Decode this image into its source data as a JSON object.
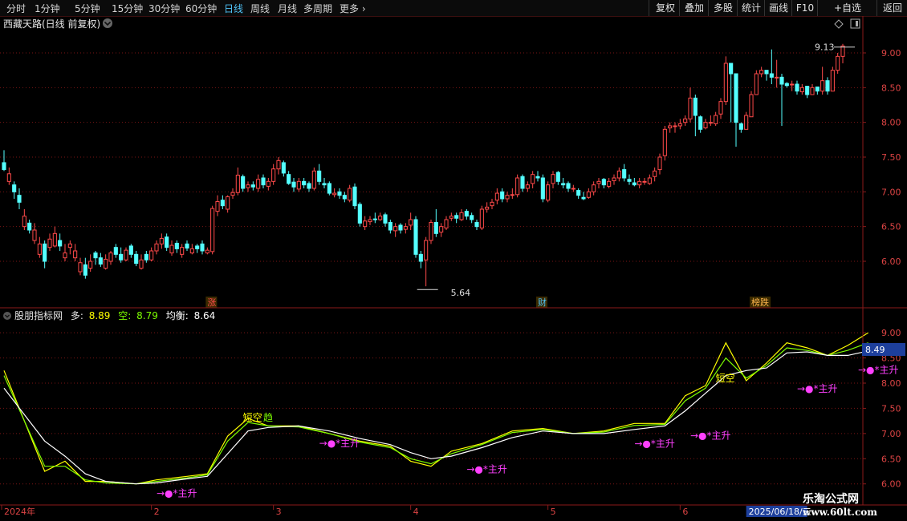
{
  "toolbar": {
    "timeframes": [
      "分时",
      "1分钟",
      "5分钟",
      "15分钟",
      "30分钟",
      "60分钟",
      "日线",
      "周线",
      "月线",
      "多周期",
      "更多"
    ],
    "active_index": 6,
    "right_buttons": [
      "复权",
      "叠加",
      "多股",
      "统计",
      "画线",
      "F10",
      "+自选",
      "返回"
    ]
  },
  "main": {
    "title": "西藏天路(日线 前复权)"
  },
  "indicator": {
    "title": "股朋指标网",
    "duo_label": "多:",
    "duo_value": "8.89",
    "kong_label": "空:",
    "kong_value": "8.79",
    "jun_label": "均衡:",
    "jun_value": "8.64",
    "current_value": "8.49"
  },
  "watermark": {
    "line1": "乐淘公式网",
    "line2": "www.60lt.com"
  },
  "colors": {
    "up": "#ff4a4a",
    "down": "#54ffff",
    "grid": "#7a1515",
    "line_duo": "#ffff00",
    "line_kong": "#7cfc00",
    "line_jun": "#ffffff",
    "signal": "#ff40ff",
    "yellow": "#ffff00",
    "green": "#7cfc00"
  },
  "chart_data": [
    {
      "type": "candlestick",
      "title": "西藏天路(日线 前复权)",
      "ylim": [
        5.55,
        9.3
      ],
      "y_ticks": [
        6.0,
        6.5,
        7.0,
        7.5,
        8.0,
        8.5,
        9.0
      ],
      "y_tick_labels": [
        "6.00",
        "6.50",
        "7.00",
        "7.50",
        "8.00",
        "8.50",
        "9.00"
      ],
      "x_labels": [
        {
          "label": "2024年",
          "index": 0
        },
        {
          "label": "2",
          "index": 29
        },
        {
          "label": "3",
          "index": 53
        },
        {
          "label": "4",
          "index": 80
        },
        {
          "label": "5",
          "index": 107
        },
        {
          "label": "6",
          "index": 133
        }
      ],
      "date_box": {
        "label": "2025/06/18/三",
        "index": 146
      },
      "annotations": [
        {
          "label": "9.13",
          "index": 168,
          "price": 9.13
        },
        {
          "label": "5.64",
          "index": 86,
          "price": 5.64
        }
      ],
      "markers": [
        {
          "label": "涨",
          "index": 40
        },
        {
          "label": "财",
          "index": 105
        },
        {
          "label": "榜跌",
          "index": 147
        }
      ],
      "close": [
        7.32,
        7.26,
        7.0,
        6.85,
        6.65,
        6.45,
        6.45,
        6.25,
        6.0,
        6.32,
        6.4,
        6.22,
        6.12,
        6.25,
        6.15,
        5.98,
        5.8,
        6.0,
        6.05,
        5.96,
        6.03,
        6.12,
        6.1,
        6.02,
        6.16,
        6.1,
        5.97,
        6.02,
        6.02,
        6.15,
        6.25,
        6.33,
        6.2,
        6.23,
        6.18,
        6.2,
        6.19,
        6.18,
        6.18,
        6.15,
        6.16,
        6.76,
        6.86,
        6.8,
        6.93,
        6.99,
        7.24,
        7.05,
        7.1,
        7.07,
        7.18,
        7.1,
        7.15,
        7.33,
        7.45,
        7.27,
        7.12,
        7.07,
        7.15,
        7.1,
        7.05,
        7.3,
        7.15,
        7.1,
        6.98,
        6.98,
        6.95,
        6.9,
        7.05,
        6.8,
        6.55,
        6.58,
        6.6,
        6.6,
        6.65,
        6.55,
        6.45,
        6.5,
        6.45,
        6.5,
        6.6,
        6.1,
        6.0,
        6.3,
        6.56,
        6.4,
        6.5,
        6.6,
        6.65,
        6.62,
        6.7,
        6.65,
        6.6,
        6.5,
        6.75,
        6.78,
        6.85,
        6.98,
        6.9,
        6.95,
        6.96,
        7.2,
        7.05,
        7.1,
        7.25,
        7.2,
        6.9,
        7.1,
        7.25,
        7.15,
        7.1,
        7.05,
        7.05,
        6.95,
        6.9,
        7.0,
        7.1,
        7.15,
        7.1,
        7.15,
        7.2,
        7.3,
        7.2,
        7.15,
        7.1,
        7.15,
        7.15,
        7.2,
        7.3,
        7.5,
        7.9,
        7.95,
        7.95,
        7.98,
        8.05,
        8.35,
        8.1,
        7.9,
        8.0,
        8.0,
        8.1,
        8.3,
        8.85,
        8.7,
        8.0,
        7.9,
        8.1,
        8.4,
        8.7,
        8.75,
        8.7,
        8.65,
        8.65,
        8.55,
        8.53,
        8.55,
        8.45,
        8.5,
        8.4,
        8.5,
        8.45,
        8.6,
        8.45,
        8.75,
        8.95,
        9.1
      ],
      "open": [
        7.42,
        7.15,
        7.1,
        6.95,
        6.5,
        6.55,
        6.3,
        6.1,
        6.25,
        6.2,
        6.22,
        6.3,
        6.05,
        6.2,
        6.05,
        5.85,
        5.95,
        5.9,
        6.12,
        6.05,
        5.9,
        6.0,
        6.2,
        6.1,
        6.02,
        6.22,
        6.1,
        5.9,
        6.1,
        6.02,
        6.15,
        6.25,
        6.35,
        6.12,
        6.26,
        6.1,
        6.25,
        6.12,
        6.22,
        6.25,
        6.12,
        6.14,
        6.72,
        6.88,
        6.75,
        6.95,
        6.99,
        7.22,
        7.06,
        7.1,
        7.05,
        7.2,
        7.08,
        7.15,
        7.33,
        7.42,
        7.25,
        7.14,
        7.04,
        7.15,
        7.12,
        7.05,
        7.3,
        7.12,
        7.12,
        6.96,
        7.0,
        6.95,
        6.88,
        7.07,
        6.82,
        6.5,
        6.57,
        6.61,
        6.6,
        6.67,
        6.56,
        6.44,
        6.52,
        6.46,
        6.52,
        6.6,
        6.1,
        6.02,
        6.3,
        6.56,
        6.42,
        6.48,
        6.62,
        6.66,
        6.6,
        6.72,
        6.66,
        6.56,
        6.48,
        6.75,
        6.8,
        6.88,
        7.0,
        6.9,
        6.96,
        6.96,
        7.22,
        7.05,
        7.12,
        7.22,
        7.2,
        6.88,
        7.12,
        7.28,
        7.12,
        7.12,
        7.05,
        7.02,
        6.92,
        6.92,
        7.0,
        7.12,
        7.18,
        7.08,
        7.16,
        7.2,
        7.32,
        7.18,
        7.13,
        7.1,
        7.15,
        7.12,
        7.22,
        7.32,
        7.52,
        7.92,
        7.95,
        7.95,
        8.0,
        8.05,
        8.35,
        8.08,
        7.92,
        8.0,
        7.98,
        8.12,
        8.3,
        8.85,
        8.7,
        7.98,
        7.9,
        8.08,
        8.4,
        8.7,
        8.75,
        8.7,
        8.65,
        8.65,
        8.56,
        8.54,
        8.55,
        8.44,
        8.52,
        8.4,
        8.51,
        8.45,
        8.6,
        8.45,
        8.75,
        8.95
      ],
      "high": [
        7.6,
        7.35,
        7.15,
        7.05,
        6.75,
        6.6,
        6.55,
        6.35,
        6.3,
        6.4,
        6.5,
        6.4,
        6.25,
        6.3,
        6.25,
        6.05,
        6.05,
        6.1,
        6.15,
        6.12,
        6.1,
        6.15,
        6.25,
        6.2,
        6.2,
        6.25,
        6.15,
        6.1,
        6.15,
        6.2,
        6.3,
        6.4,
        6.4,
        6.3,
        6.3,
        6.25,
        6.3,
        6.25,
        6.25,
        6.3,
        6.2,
        6.8,
        6.95,
        6.95,
        6.95,
        7.05,
        7.35,
        7.25,
        7.15,
        7.15,
        7.25,
        7.25,
        7.2,
        7.4,
        7.5,
        7.45,
        7.3,
        7.2,
        7.2,
        7.2,
        7.15,
        7.35,
        7.4,
        7.2,
        7.15,
        7.05,
        7.05,
        7.0,
        7.1,
        7.12,
        6.85,
        6.65,
        6.65,
        6.7,
        6.7,
        6.7,
        6.6,
        6.55,
        6.55,
        6.55,
        6.7,
        6.65,
        6.15,
        6.35,
        6.6,
        6.75,
        6.55,
        6.65,
        6.7,
        6.7,
        6.75,
        6.75,
        6.7,
        6.6,
        6.8,
        6.85,
        6.9,
        7.05,
        7.05,
        7.0,
        7.05,
        7.25,
        7.25,
        7.15,
        7.3,
        7.3,
        7.25,
        7.15,
        7.3,
        7.3,
        7.2,
        7.15,
        7.1,
        7.05,
        7.0,
        7.05,
        7.15,
        7.2,
        7.2,
        7.2,
        7.25,
        7.35,
        7.4,
        7.25,
        7.2,
        7.2,
        7.2,
        7.25,
        7.35,
        7.55,
        7.95,
        8.0,
        8.0,
        8.05,
        8.1,
        8.5,
        8.4,
        8.1,
        8.05,
        8.1,
        8.15,
        8.35,
        8.95,
        8.85,
        8.7,
        8.0,
        8.15,
        8.45,
        8.75,
        8.8,
        8.75,
        9.05,
        8.9,
        8.7,
        8.58,
        8.6,
        8.6,
        8.55,
        8.5,
        8.55,
        8.5,
        8.8,
        8.65,
        8.8,
        9.0,
        9.13
      ],
      "low": [
        7.3,
        7.1,
        6.9,
        6.75,
        6.45,
        6.4,
        6.25,
        6.05,
        5.9,
        6.15,
        6.2,
        6.15,
        6.0,
        6.1,
        6.0,
        5.8,
        5.75,
        5.85,
        5.95,
        5.92,
        5.88,
        5.95,
        6.05,
        5.98,
        6.0,
        6.05,
        5.93,
        5.88,
        5.98,
        6.0,
        6.1,
        6.18,
        6.15,
        6.08,
        6.12,
        6.05,
        6.15,
        6.1,
        6.12,
        6.1,
        6.1,
        6.1,
        6.65,
        6.75,
        6.7,
        6.9,
        6.95,
        7.0,
        7.0,
        7.02,
        7.0,
        7.05,
        7.02,
        7.1,
        7.25,
        7.22,
        7.1,
        7.0,
        7.0,
        7.05,
        7.0,
        7.02,
        7.1,
        7.05,
        6.95,
        6.92,
        6.9,
        6.85,
        6.85,
        6.75,
        6.5,
        6.45,
        6.52,
        6.55,
        6.58,
        6.5,
        6.4,
        6.35,
        6.4,
        6.4,
        6.45,
        6.05,
        5.9,
        5.64,
        6.25,
        6.35,
        6.35,
        6.45,
        6.58,
        6.55,
        6.58,
        6.6,
        6.55,
        6.45,
        6.45,
        6.7,
        6.75,
        6.82,
        6.85,
        6.85,
        6.9,
        6.92,
        7.0,
        7.0,
        7.05,
        7.15,
        6.85,
        6.85,
        7.05,
        7.1,
        7.05,
        7.0,
        7.0,
        6.9,
        6.88,
        6.9,
        6.95,
        7.05,
        7.05,
        7.05,
        7.1,
        7.15,
        7.15,
        7.1,
        7.08,
        7.05,
        7.1,
        7.1,
        7.15,
        7.25,
        7.45,
        7.85,
        7.85,
        7.9,
        7.95,
        8.0,
        7.8,
        7.85,
        7.9,
        7.95,
        7.95,
        8.05,
        8.25,
        8.0,
        7.65,
        7.85,
        8.05,
        8.35,
        8.65,
        8.65,
        8.6,
        8.55,
        8.5,
        7.95,
        8.5,
        8.45,
        8.4,
        8.4,
        8.35,
        8.4,
        8.4,
        8.4,
        8.4,
        8.45,
        8.7,
        8.85
      ]
    },
    {
      "type": "line",
      "title": "股朋指标网",
      "ylim": [
        5.9,
        9.4
      ],
      "y_ticks": [
        6.0,
        6.5,
        7.0,
        7.5,
        8.0,
        8.5,
        9.0
      ],
      "y_tick_labels": [
        "6.00",
        "6.50",
        "7.00",
        "7.50",
        "8.00",
        "8.50",
        "9.00"
      ],
      "series": [
        {
          "name": "多",
          "x": [
            0,
            8,
            12,
            16,
            20,
            26,
            30,
            36,
            40,
            44,
            48,
            52,
            58,
            64,
            70,
            76,
            80,
            84,
            88,
            94,
            100,
            106,
            112,
            118,
            124,
            130,
            134,
            138,
            142,
            146,
            150,
            154,
            158,
            162,
            166,
            170
          ],
          "values": [
            8.25,
            6.25,
            6.45,
            6.05,
            6.05,
            6.0,
            6.08,
            6.15,
            6.2,
            6.95,
            7.3,
            7.15,
            7.15,
            7.0,
            6.85,
            6.75,
            6.45,
            6.35,
            6.65,
            6.8,
            7.05,
            7.1,
            7.0,
            7.05,
            7.2,
            7.2,
            7.75,
            7.95,
            8.8,
            8.05,
            8.4,
            8.8,
            8.7,
            8.55,
            8.75,
            9.0
          ]
        },
        {
          "name": "空",
          "x": [
            0,
            8,
            12,
            16,
            20,
            26,
            30,
            36,
            40,
            44,
            48,
            52,
            58,
            64,
            70,
            76,
            80,
            84,
            88,
            94,
            100,
            106,
            112,
            118,
            124,
            130,
            134,
            138,
            142,
            146,
            150,
            154,
            158,
            162,
            166,
            170
          ],
          "values": [
            8.15,
            6.35,
            6.35,
            6.08,
            6.02,
            6.0,
            6.05,
            6.12,
            6.18,
            6.85,
            7.22,
            7.15,
            7.13,
            7.0,
            6.83,
            6.72,
            6.5,
            6.4,
            6.6,
            6.78,
            7.02,
            7.08,
            7.0,
            7.03,
            7.16,
            7.18,
            7.65,
            7.9,
            8.5,
            8.1,
            8.35,
            8.7,
            8.65,
            8.55,
            8.65,
            8.8
          ]
        },
        {
          "name": "均衡",
          "x": [
            0,
            8,
            12,
            16,
            20,
            26,
            30,
            36,
            40,
            44,
            48,
            52,
            58,
            64,
            70,
            76,
            80,
            84,
            88,
            94,
            100,
            106,
            112,
            118,
            124,
            130,
            134,
            138,
            142,
            146,
            150,
            154,
            158,
            162,
            166,
            170
          ],
          "values": [
            7.9,
            6.85,
            6.55,
            6.2,
            6.05,
            6.0,
            6.02,
            6.1,
            6.15,
            6.6,
            7.05,
            7.12,
            7.15,
            7.05,
            6.9,
            6.78,
            6.62,
            6.5,
            6.55,
            6.72,
            6.92,
            7.05,
            7.0,
            7.0,
            7.08,
            7.15,
            7.45,
            7.8,
            8.15,
            8.25,
            8.3,
            8.6,
            8.62,
            8.55,
            8.55,
            8.64
          ]
        }
      ],
      "signals": [
        {
          "label": "→●*主升",
          "index": 30,
          "value": 6.0
        },
        {
          "label": "→●*主升",
          "index": 62,
          "value": 7.0
        },
        {
          "label": "→●*主升",
          "index": 91,
          "value": 6.48
        },
        {
          "label": "→●*主升",
          "index": 124,
          "value": 6.99
        },
        {
          "label": "→●*主升",
          "index": 135,
          "value": 7.15
        },
        {
          "label": "→●*主升",
          "index": 156,
          "value": 8.08
        },
        {
          "label": "→●*主升",
          "index": 168,
          "value": 8.45
        }
      ],
      "labels": [
        {
          "label": "短空",
          "index": 47,
          "value": 7.25,
          "color": "yellow"
        },
        {
          "label": "趋",
          "index": 51,
          "value": 7.25,
          "color": "green"
        },
        {
          "label": "短空",
          "index": 140,
          "value": 8.03,
          "color": "yellow"
        }
      ]
    }
  ]
}
